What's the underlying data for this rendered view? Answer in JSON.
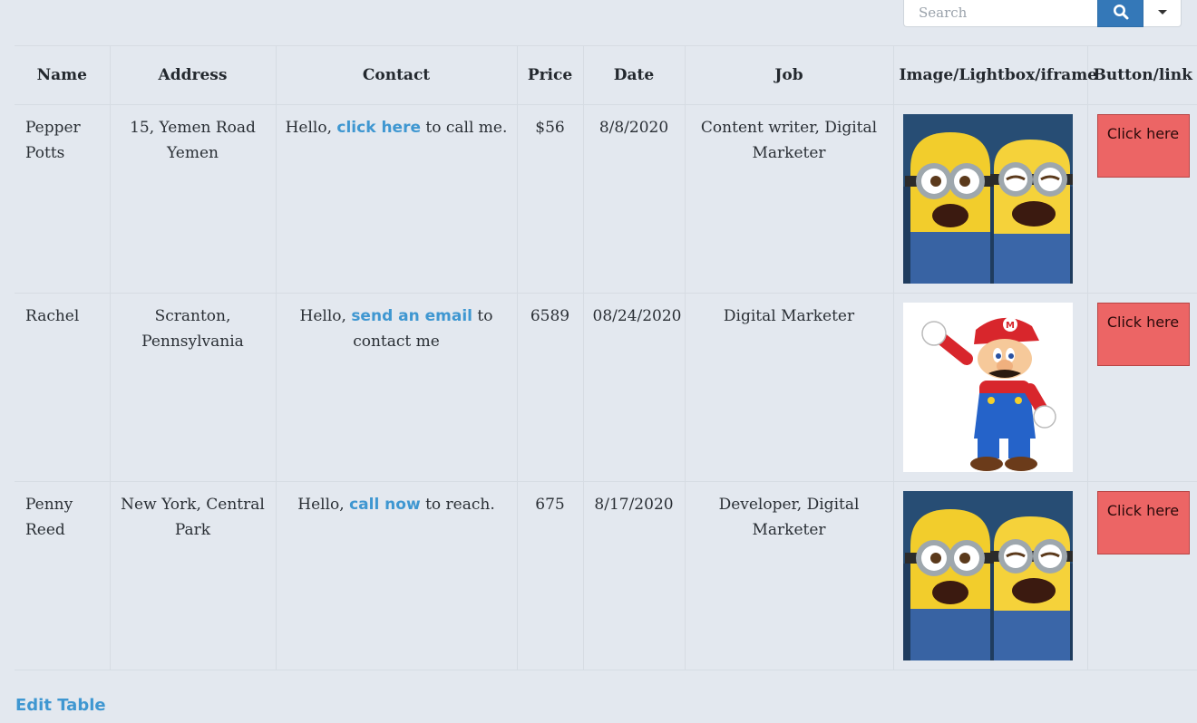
{
  "search": {
    "placeholder": "Search",
    "search_icon": "search-icon",
    "dropdown_icon": "caret-down-icon"
  },
  "table": {
    "headers": [
      "Name",
      "Address",
      "Contact",
      "Price",
      "Date",
      "Job",
      "Image/Lightbox/iframe",
      "Button/link"
    ],
    "rows": [
      {
        "name": "Pepper Potts",
        "address": "15, Yemen Road Yemen",
        "contact_prefix": "Hello,",
        "contact_link": "click here",
        "contact_suffix": "to call me.",
        "price": "$56",
        "date": "8/8/2020",
        "job": "Content writer, Digital Marketer",
        "image": "minions-image",
        "button": "Click here"
      },
      {
        "name": "Rachel",
        "address": "Scranton, Pennsylvania",
        "contact_prefix": "Hello,",
        "contact_link": "send an email",
        "contact_suffix": "to contact me",
        "price": "6589",
        "date": "08/24/2020",
        "job": "Digital Marketer",
        "image": "mario-image",
        "button": "Click here"
      },
      {
        "name": "Penny Reed",
        "address": "New York, Central Park",
        "contact_prefix": "Hello,",
        "contact_link": "call now",
        "contact_suffix": "to reach.",
        "price": "675",
        "date": "8/17/2020",
        "job": "Developer, Digital Marketer",
        "image": "minions-image",
        "button": "Click here"
      }
    ]
  },
  "footer": {
    "edit_label": "Edit Table"
  },
  "colors": {
    "background": "#e3e8ef",
    "link": "#3f97d1",
    "search_button": "#3478b8",
    "click_button": "#ec6565"
  }
}
